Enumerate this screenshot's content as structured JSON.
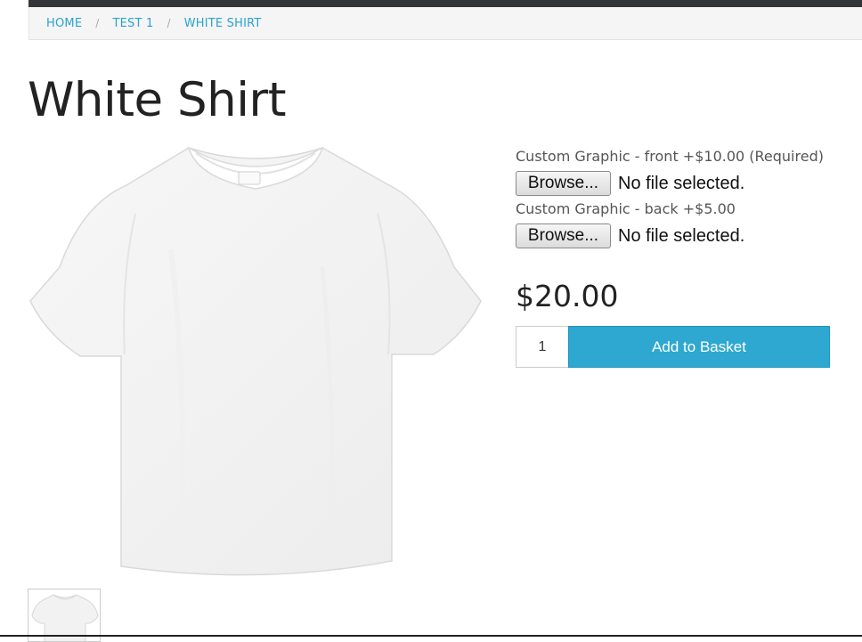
{
  "breadcrumb": {
    "items": [
      {
        "label": "HOME"
      },
      {
        "label": "TEST 1"
      },
      {
        "label": "WHITE SHIRT"
      }
    ],
    "separator": "/"
  },
  "product": {
    "title": "White Shirt",
    "price": "$20.00",
    "image_icon": "tshirt-image"
  },
  "options": [
    {
      "label": "Custom Graphic - front +$10.00 (Required)",
      "button": "Browse...",
      "status": "No file selected."
    },
    {
      "label": "Custom Graphic - back +$5.00",
      "button": "Browse...",
      "status": "No file selected."
    }
  ],
  "basket": {
    "quantity": "1",
    "add_label": "Add to Basket"
  },
  "colors": {
    "accent": "#2ea8d0",
    "link": "#2aa3cf",
    "topbar": "#333537"
  }
}
